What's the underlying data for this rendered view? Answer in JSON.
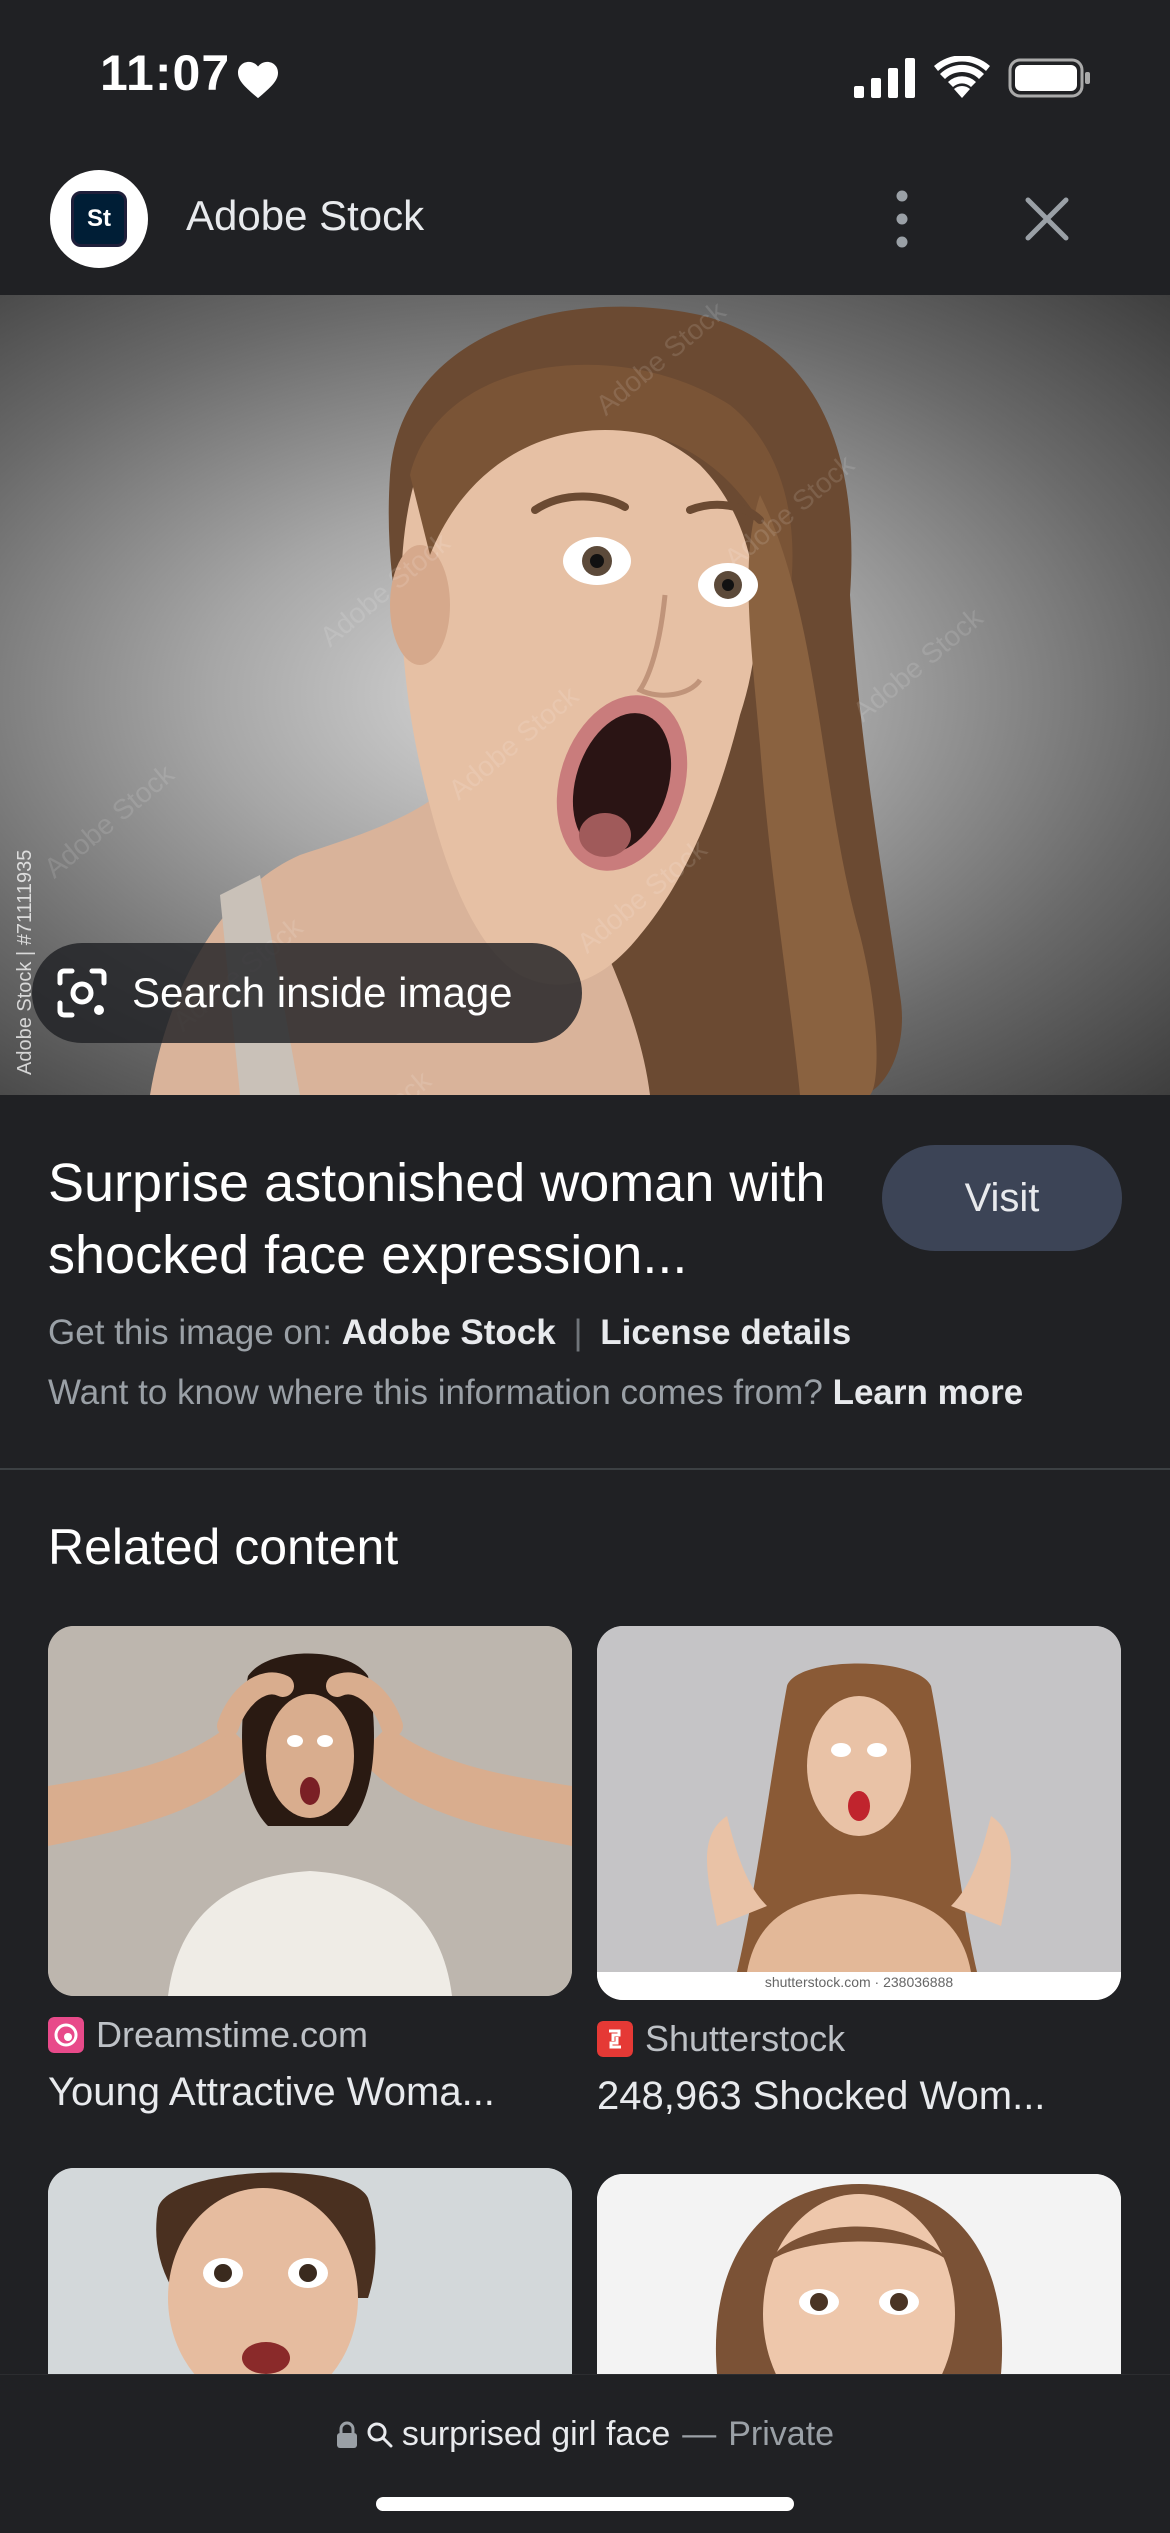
{
  "status_bar": {
    "time": "11:07"
  },
  "header": {
    "site_name": "Adobe Stock",
    "logo_text": "St"
  },
  "hero": {
    "credit": "Adobe Stock | #71111935",
    "search_inside_label": "Search inside image"
  },
  "info": {
    "title": "Surprise astonished woman with shocked face expression...",
    "visit_label": "Visit",
    "get_image_prefix": "Get this image on:",
    "get_image_source": "Adobe Stock",
    "separator": "|",
    "license_details": "License details",
    "learn_prefix": "Want to know where this information comes from?",
    "learn_more": "Learn more"
  },
  "related": {
    "heading": "Related content",
    "items": [
      {
        "source": "Dreamstime.com",
        "caption": "Young Attractive Woma..."
      },
      {
        "source": "Shutterstock",
        "caption": "248,963 Shocked Wom..."
      },
      {
        "source": "",
        "caption": ""
      },
      {
        "source": "",
        "caption": ""
      }
    ],
    "watermark_text": "shutterstock.com · 238036888"
  },
  "bottom_bar": {
    "query": "surprised girl face",
    "dash": "—",
    "mode": "Private"
  },
  "colors": {
    "background": "#202124",
    "visit_button": "#3c4456",
    "dreamstime_favicon": "#e84a8a",
    "shutterstock_favicon": "#e53935"
  }
}
